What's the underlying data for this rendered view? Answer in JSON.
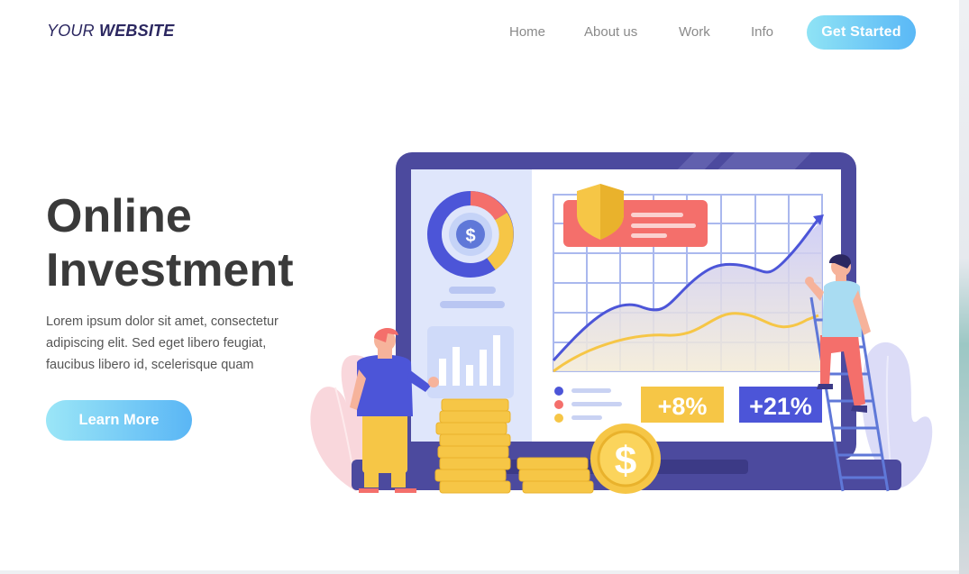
{
  "header": {
    "logo_light": "YOUR",
    "logo_bold": "WEBSITE",
    "nav": [
      {
        "label": "Home"
      },
      {
        "label": "About us"
      },
      {
        "label": "Work"
      },
      {
        "label": "Info"
      }
    ],
    "cta_label": "Get Started"
  },
  "hero": {
    "title_line1": "Online",
    "title_line2": "Investment",
    "text_lines": [
      "Lorem ipsum dolor sit amet, consectetur",
      "adipiscing elit. Sed eget libero feugiat,",
      "faucibus libero id, scelerisque quam"
    ],
    "cta_label": "Learn More"
  },
  "illustration": {
    "currency_symbol": "$",
    "stat_left": "+8%",
    "stat_right": "+21%"
  },
  "colors": {
    "brand": "#2b2760",
    "accent_start": "#8fe3f5",
    "accent_end": "#5ab8f6",
    "laptop": "#4c4a9e",
    "stat_yellow": "#f6c646",
    "stat_blue": "#4c55d8",
    "card_red": "#f46f6b"
  }
}
